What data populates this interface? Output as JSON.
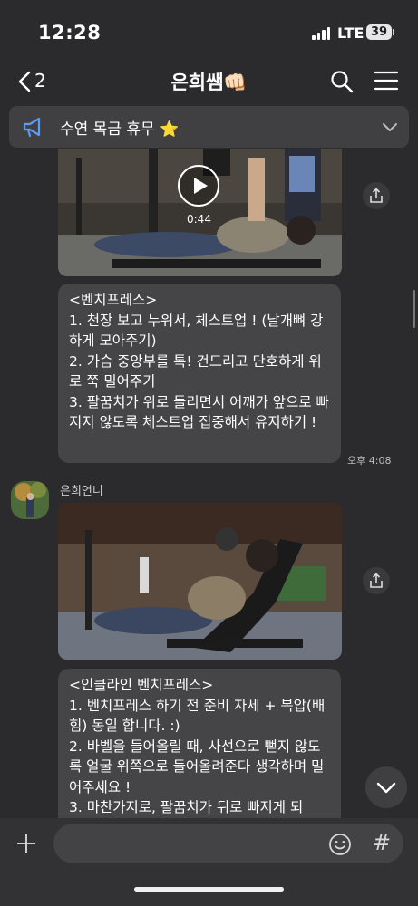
{
  "status_bar": {
    "time": "12:28",
    "network": "LTE",
    "battery": "39"
  },
  "header": {
    "back_count": "2",
    "title": "은희쌤👊🏻"
  },
  "notice": {
    "text": "수연 목금 휴무 ⭐️"
  },
  "messages": [
    {
      "video_duration": "0:44",
      "text": "<벤치프레스>\n1. 천장 보고 누워서, 체스트업 ! (날개뼈 강하게 모아주기)\n2. 가슴 중앙부를 톡! 건드리고 단호하게 위로 쭉 밀어주기\n3. 팔꿈치가 위로 들리면서 어깨가 앞으로 빠지지 않도록 체스트업 집중해서 유지하기 !",
      "time": "오후 4:08"
    },
    {
      "sender": "은희언니",
      "text": "<인클라인 벤치프레스>\n1. 벤치프레스 하기 전 준비 자세 + 복압(배힘) 동일 합니다. :)\n2. 바벨을 들어올릴 때, 사선으로 뻗지 않도록 얼굴 위쪽으로 들어올려준다 생각하며 밀어주세요 !\n3. 마찬가지로, 팔꿈치가 뒤로 빠지게 되"
    }
  ],
  "icons": {
    "back": "chevron-left-icon",
    "search": "search-icon",
    "menu": "menu-icon",
    "notice": "megaphone-icon",
    "share": "share-icon",
    "play": "play-icon",
    "scroll_down": "chevron-down-icon",
    "plus": "plus-icon",
    "emoji": "emoji-icon",
    "hash": "hash-icon"
  },
  "input": {
    "hash_symbol": "#"
  },
  "colors": {
    "background": "#2b2b2d",
    "bubble": "#454547",
    "notice": "#404043",
    "megaphone": "#5b9cf5"
  }
}
